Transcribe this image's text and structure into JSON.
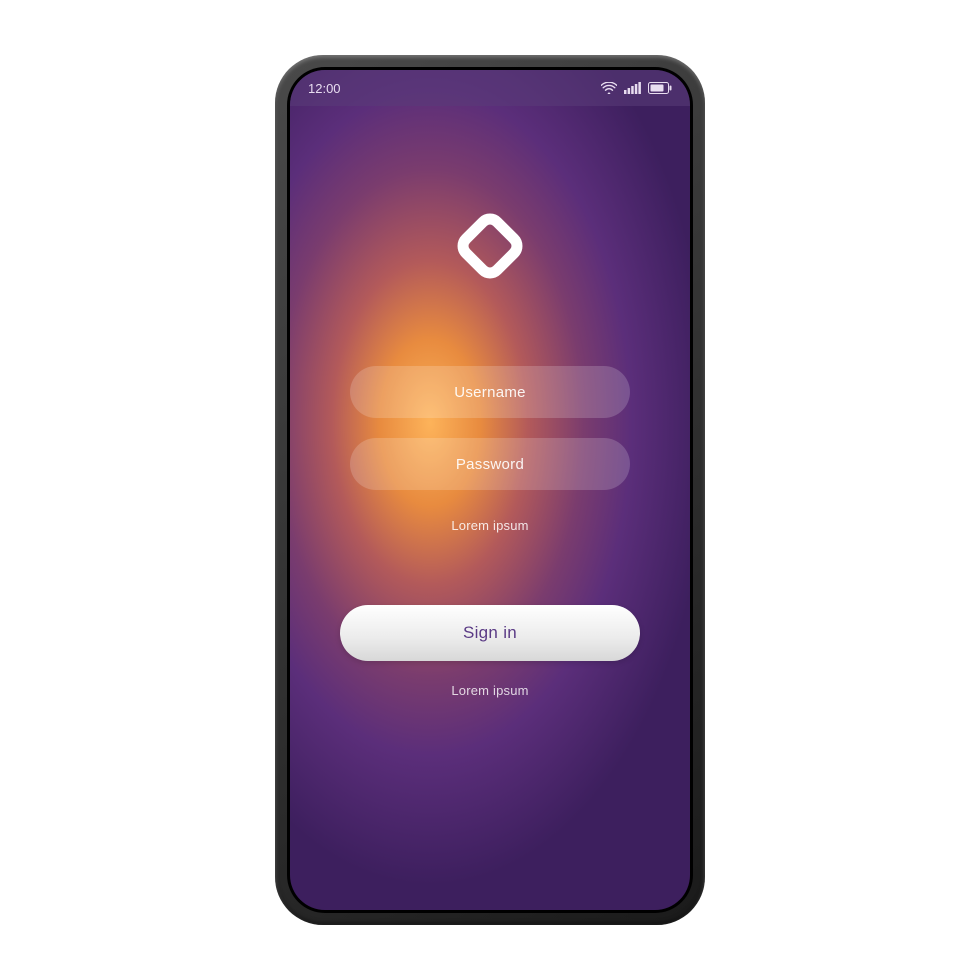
{
  "statusBar": {
    "time": "12:00"
  },
  "form": {
    "usernamePlaceholder": "Username",
    "passwordPlaceholder": "Password",
    "helperText": "Lorem ipsum"
  },
  "actions": {
    "signInLabel": "Sign in",
    "footerText": "Lorem ipsum"
  }
}
